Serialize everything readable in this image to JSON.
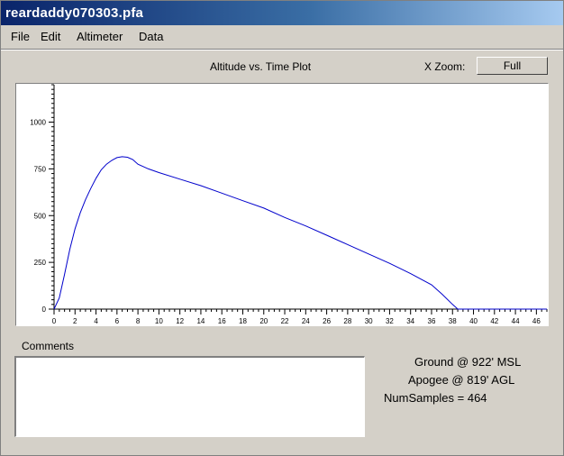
{
  "window": {
    "title": "reardaddy070303.pfa"
  },
  "menu": {
    "items": [
      {
        "label": "File"
      },
      {
        "label": "Edit"
      },
      {
        "label": "Altimeter"
      },
      {
        "label": "Data"
      }
    ]
  },
  "plot": {
    "title": "Altitude vs. Time Plot"
  },
  "xzoom": {
    "label": "X Zoom:",
    "button_label": "Full"
  },
  "chart_data": {
    "type": "line",
    "title": "Altitude vs. Time Plot",
    "xlabel": "",
    "ylabel": "",
    "xlim": [
      0,
      47
    ],
    "ylim": [
      0,
      1200
    ],
    "x_ticks": [
      0,
      2,
      4,
      6,
      8,
      10,
      12,
      14,
      16,
      18,
      20,
      22,
      24,
      26,
      28,
      30,
      32,
      34,
      36,
      38,
      40,
      42,
      44,
      46
    ],
    "y_ticks": [
      0,
      250,
      500,
      750,
      1000
    ],
    "grid": false,
    "line_color": "#0000cc",
    "series": [
      {
        "x": [
          0,
          0.5,
          1,
          1.5,
          2,
          2.5,
          3,
          3.5,
          4,
          4.5,
          5,
          5.5,
          6,
          6.5,
          7,
          7.5,
          8,
          9,
          10,
          12,
          14,
          16,
          18,
          20,
          22,
          24,
          26,
          28,
          30,
          32,
          34,
          36,
          37,
          38,
          38.5,
          40,
          42,
          44,
          46,
          47
        ],
        "y": [
          0,
          60,
          185,
          320,
          430,
          515,
          585,
          645,
          700,
          745,
          775,
          795,
          810,
          815,
          812,
          800,
          775,
          750,
          730,
          695,
          660,
          620,
          580,
          540,
          490,
          445,
          395,
          345,
          295,
          245,
          190,
          130,
          80,
          25,
          0,
          0,
          0,
          0,
          0,
          0
        ]
      }
    ]
  },
  "comments": {
    "label": "Comments",
    "value": ""
  },
  "stats": {
    "ground": "Ground @  922' MSL",
    "apogee": "Apogee @  819' AGL",
    "num_samples": "NumSamples =  464"
  }
}
